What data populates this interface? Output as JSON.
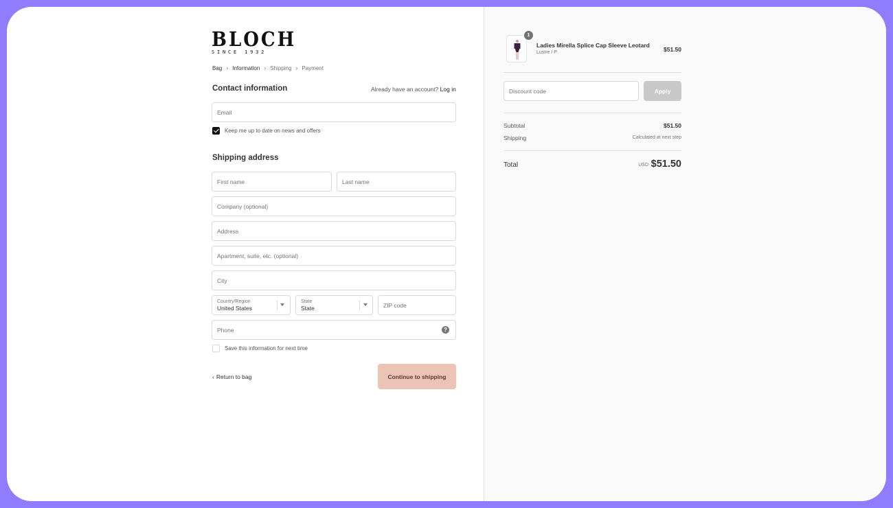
{
  "brand": {
    "name": "BLOCH",
    "tagline": "SINCE 1932"
  },
  "breadcrumb": [
    "Bag",
    "Information",
    "Shipping",
    "Payment"
  ],
  "contact": {
    "title": "Contact information",
    "login_prompt": "Already have an account?",
    "login_link": "Log in",
    "email_placeholder": "Email",
    "newsletter_label": "Keep me up to date on news and offers",
    "newsletter_checked": true
  },
  "shipping": {
    "title": "Shipping address",
    "first_name_placeholder": "First name",
    "last_name_placeholder": "Last name",
    "company_placeholder": "Company (optional)",
    "address_placeholder": "Address",
    "apartment_placeholder": "Apartment, suite, etc. (optional)",
    "city_placeholder": "City",
    "country_label": "Country/Region",
    "country_value": "United States",
    "state_label": "State",
    "state_value": "State",
    "zip_placeholder": "ZIP code",
    "phone_placeholder": "Phone",
    "save_info_label": "Save this information for next time",
    "save_info_checked": false
  },
  "actions": {
    "return_label": "Return to bag",
    "continue_label": "Continue to shipping"
  },
  "order": {
    "item": {
      "quantity": "1",
      "name": "Ladies Mirella Splice Cap Sleeve Leotard",
      "variant": "Lustre / P",
      "price": "$51.50"
    },
    "discount_placeholder": "Discount code",
    "apply_label": "Apply",
    "subtotal_label": "Subtotal",
    "subtotal_value": "$51.50",
    "shipping_label": "Shipping",
    "shipping_value": "Calculated at next step",
    "total_label": "Total",
    "total_currency": "USD",
    "total_value": "$51.50"
  },
  "colors": {
    "frame": "#8f7cff",
    "primary_button": "#ebc4b6",
    "apply_button": "#c8c8c8"
  }
}
